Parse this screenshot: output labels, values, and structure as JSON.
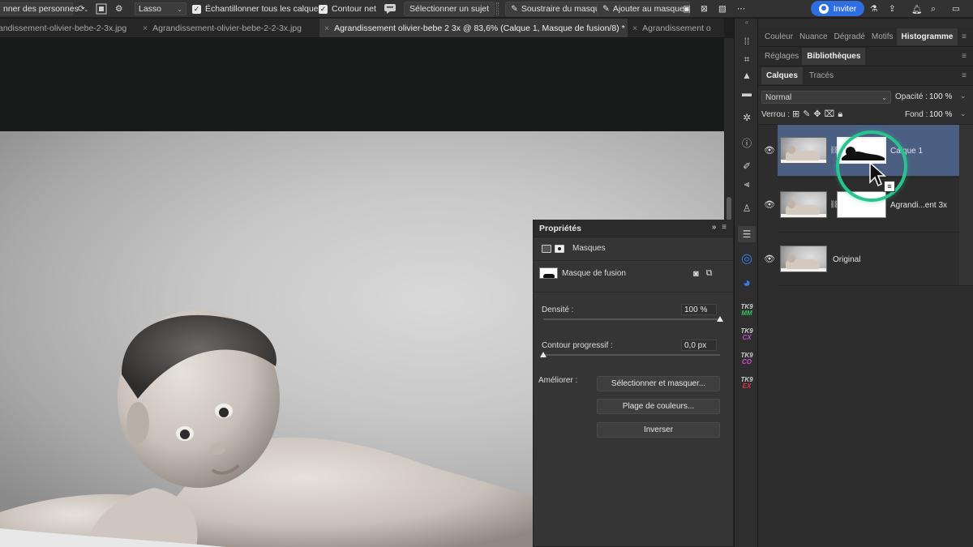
{
  "options_bar": {
    "select_people": "nner des personnes",
    "mode": "Lasso",
    "sample_all": "Échantillonner tous les calques",
    "sharp_edge": "Contour net",
    "select_subject": "Sélectionner un sujet",
    "subtract_mask": "Soustraire du masque",
    "add_mask": "Ajouter au masque",
    "invite": "Inviter"
  },
  "tabs": [
    {
      "label": "andissement-olivier-bebe-2-3x.jpg",
      "active": false
    },
    {
      "label": "Agrandissement-olivier-bebe-2-2-3x.jpg",
      "active": false
    },
    {
      "label": "Agrandissement olivier-bebe 2 3x @ 83,6% (Calque 1, Masque de fusion/8) *",
      "active": true
    },
    {
      "label": "Agrandissement o",
      "active": false
    }
  ],
  "properties": {
    "title": "Propriétés",
    "masks_label": "Masques",
    "mask_type": "Masque de fusion",
    "density_label": "Densité :",
    "density_value": "100 %",
    "density": 100,
    "feather_label": "Contour progressif :",
    "feather_value": "0,0 px",
    "feather": 0,
    "refine_label": "Améliorer :",
    "btn_select_mask": "Sélectionner et masquer...",
    "btn_color_range": "Plage de couleurs...",
    "btn_invert": "Inverser"
  },
  "tool_column": {
    "tk1": [
      "TK9",
      "MM"
    ],
    "tk2": [
      "TK9",
      "CX"
    ],
    "tk3": [
      "TK9",
      "CO"
    ],
    "tk4": [
      "TK9",
      "EX"
    ],
    "tk_colors": [
      "#35c35a",
      "#c04bd8",
      "#d84bd8",
      "#e0384a"
    ]
  },
  "panels": {
    "row1": [
      "Couleur",
      "Nuance",
      "Dégradé",
      "Motifs",
      "Histogramme"
    ],
    "row1_active": "Histogramme",
    "row2": [
      "Réglages",
      "Bibliothèques"
    ],
    "row2_active": "Bibliothèques",
    "row3": [
      "Calques",
      "Tracés"
    ],
    "row3_active": "Calques",
    "blend_mode": "Normal",
    "opacity_label": "Opacité :",
    "opacity_value": "100 %",
    "lock_label": "Verrou :",
    "fill_label": "Fond :",
    "fill_value": "100 %"
  },
  "layers": [
    {
      "name": "Calque 1",
      "selected": true,
      "has_mask": true
    },
    {
      "name": "Agrandi...ent 3x",
      "selected": false,
      "has_mask": true
    },
    {
      "name": "Original",
      "selected": false,
      "has_mask": false
    }
  ],
  "accent_colors": {
    "highlight_ring": "#27c48f",
    "selected_layer": "#4b5f83",
    "invite_button": "#2f6ee0"
  }
}
